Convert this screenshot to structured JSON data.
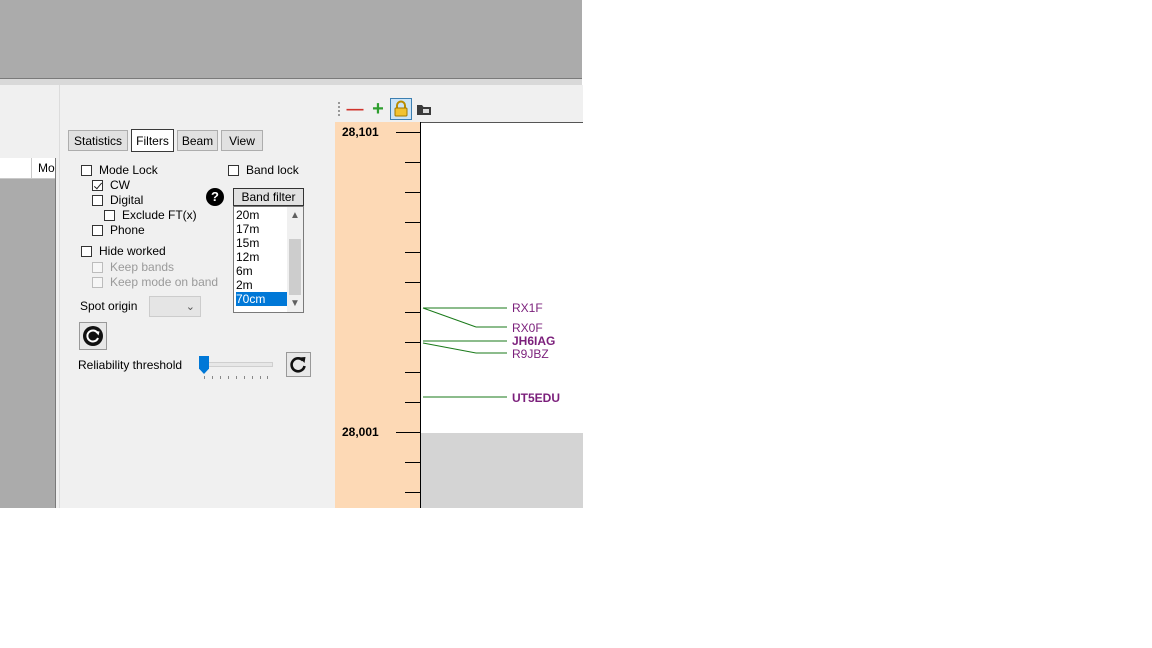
{
  "grid": {
    "column_header": "Mo"
  },
  "tabs": [
    {
      "label": "Statistics",
      "active": false
    },
    {
      "label": "Filters",
      "active": true
    },
    {
      "label": "Beam",
      "active": false
    },
    {
      "label": "View",
      "active": false
    }
  ],
  "filters": {
    "mode_lock": {
      "label": "Mode Lock",
      "checked": false
    },
    "cw": {
      "label": "CW",
      "checked": true
    },
    "digital": {
      "label": "Digital",
      "checked": false
    },
    "exclude_ft": {
      "label": "Exclude FT(x)",
      "checked": false
    },
    "phone": {
      "label": "Phone",
      "checked": false
    },
    "hide_worked": {
      "label": "Hide worked",
      "checked": false
    },
    "keep_bands": {
      "label": "Keep bands",
      "checked": false,
      "enabled": false
    },
    "keep_mode_on_band": {
      "label": "Keep mode on band",
      "checked": false,
      "enabled": false
    },
    "band_lock": {
      "label": "Band lock",
      "checked": false
    },
    "help_icon": "?",
    "band_filter": {
      "header": "Band filter",
      "items": [
        "20m",
        "17m",
        "15m",
        "12m",
        "6m",
        "2m",
        "70cm"
      ],
      "selected": "70cm"
    },
    "spot_origin": {
      "label": "Spot origin",
      "value": ""
    },
    "reliability": {
      "label": "Reliability threshold",
      "value": 0
    }
  },
  "toolbar": {
    "icons": [
      "zoom-out-icon",
      "zoom-in-icon",
      "lock-icon",
      "folder-icon"
    ]
  },
  "bandmap": {
    "freq_top": "28,101",
    "freq_bottom": "28,001",
    "spots": [
      {
        "call": "RX1F",
        "bold": false
      },
      {
        "call": "RX0F",
        "bold": false
      },
      {
        "call": "JH6IAG",
        "bold": true
      },
      {
        "call": "R9JBZ",
        "bold": false
      },
      {
        "call": "UT5EDU",
        "bold": true
      }
    ],
    "colors": {
      "spot_text": "#7b1f7b",
      "spot_line": "#1a7a1a",
      "freq_bg": "#fdd9b5"
    }
  }
}
